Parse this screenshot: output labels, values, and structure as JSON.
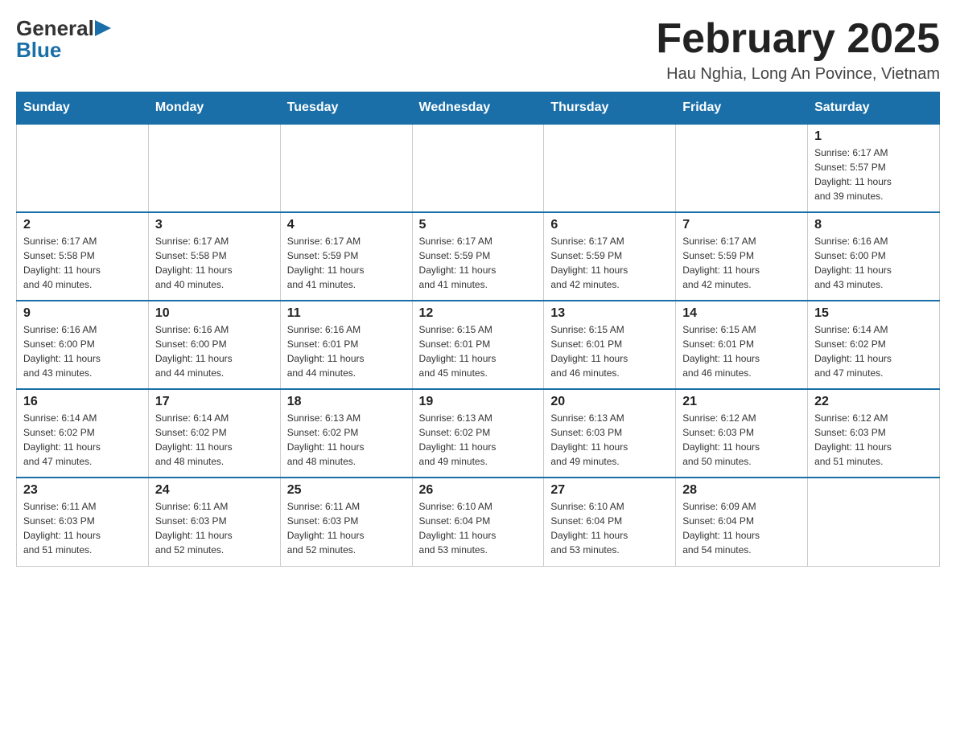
{
  "header": {
    "month_year": "February 2025",
    "location": "Hau Nghia, Long An Povince, Vietnam",
    "logo_general": "General",
    "logo_blue": "Blue"
  },
  "days_of_week": [
    "Sunday",
    "Monday",
    "Tuesday",
    "Wednesday",
    "Thursday",
    "Friday",
    "Saturday"
  ],
  "weeks": [
    [
      {
        "day": "",
        "info": ""
      },
      {
        "day": "",
        "info": ""
      },
      {
        "day": "",
        "info": ""
      },
      {
        "day": "",
        "info": ""
      },
      {
        "day": "",
        "info": ""
      },
      {
        "day": "",
        "info": ""
      },
      {
        "day": "1",
        "info": "Sunrise: 6:17 AM\nSunset: 5:57 PM\nDaylight: 11 hours\nand 39 minutes."
      }
    ],
    [
      {
        "day": "2",
        "info": "Sunrise: 6:17 AM\nSunset: 5:58 PM\nDaylight: 11 hours\nand 40 minutes."
      },
      {
        "day": "3",
        "info": "Sunrise: 6:17 AM\nSunset: 5:58 PM\nDaylight: 11 hours\nand 40 minutes."
      },
      {
        "day": "4",
        "info": "Sunrise: 6:17 AM\nSunset: 5:59 PM\nDaylight: 11 hours\nand 41 minutes."
      },
      {
        "day": "5",
        "info": "Sunrise: 6:17 AM\nSunset: 5:59 PM\nDaylight: 11 hours\nand 41 minutes."
      },
      {
        "day": "6",
        "info": "Sunrise: 6:17 AM\nSunset: 5:59 PM\nDaylight: 11 hours\nand 42 minutes."
      },
      {
        "day": "7",
        "info": "Sunrise: 6:17 AM\nSunset: 5:59 PM\nDaylight: 11 hours\nand 42 minutes."
      },
      {
        "day": "8",
        "info": "Sunrise: 6:16 AM\nSunset: 6:00 PM\nDaylight: 11 hours\nand 43 minutes."
      }
    ],
    [
      {
        "day": "9",
        "info": "Sunrise: 6:16 AM\nSunset: 6:00 PM\nDaylight: 11 hours\nand 43 minutes."
      },
      {
        "day": "10",
        "info": "Sunrise: 6:16 AM\nSunset: 6:00 PM\nDaylight: 11 hours\nand 44 minutes."
      },
      {
        "day": "11",
        "info": "Sunrise: 6:16 AM\nSunset: 6:01 PM\nDaylight: 11 hours\nand 44 minutes."
      },
      {
        "day": "12",
        "info": "Sunrise: 6:15 AM\nSunset: 6:01 PM\nDaylight: 11 hours\nand 45 minutes."
      },
      {
        "day": "13",
        "info": "Sunrise: 6:15 AM\nSunset: 6:01 PM\nDaylight: 11 hours\nand 46 minutes."
      },
      {
        "day": "14",
        "info": "Sunrise: 6:15 AM\nSunset: 6:01 PM\nDaylight: 11 hours\nand 46 minutes."
      },
      {
        "day": "15",
        "info": "Sunrise: 6:14 AM\nSunset: 6:02 PM\nDaylight: 11 hours\nand 47 minutes."
      }
    ],
    [
      {
        "day": "16",
        "info": "Sunrise: 6:14 AM\nSunset: 6:02 PM\nDaylight: 11 hours\nand 47 minutes."
      },
      {
        "day": "17",
        "info": "Sunrise: 6:14 AM\nSunset: 6:02 PM\nDaylight: 11 hours\nand 48 minutes."
      },
      {
        "day": "18",
        "info": "Sunrise: 6:13 AM\nSunset: 6:02 PM\nDaylight: 11 hours\nand 48 minutes."
      },
      {
        "day": "19",
        "info": "Sunrise: 6:13 AM\nSunset: 6:02 PM\nDaylight: 11 hours\nand 49 minutes."
      },
      {
        "day": "20",
        "info": "Sunrise: 6:13 AM\nSunset: 6:03 PM\nDaylight: 11 hours\nand 49 minutes."
      },
      {
        "day": "21",
        "info": "Sunrise: 6:12 AM\nSunset: 6:03 PM\nDaylight: 11 hours\nand 50 minutes."
      },
      {
        "day": "22",
        "info": "Sunrise: 6:12 AM\nSunset: 6:03 PM\nDaylight: 11 hours\nand 51 minutes."
      }
    ],
    [
      {
        "day": "23",
        "info": "Sunrise: 6:11 AM\nSunset: 6:03 PM\nDaylight: 11 hours\nand 51 minutes."
      },
      {
        "day": "24",
        "info": "Sunrise: 6:11 AM\nSunset: 6:03 PM\nDaylight: 11 hours\nand 52 minutes."
      },
      {
        "day": "25",
        "info": "Sunrise: 6:11 AM\nSunset: 6:03 PM\nDaylight: 11 hours\nand 52 minutes."
      },
      {
        "day": "26",
        "info": "Sunrise: 6:10 AM\nSunset: 6:04 PM\nDaylight: 11 hours\nand 53 minutes."
      },
      {
        "day": "27",
        "info": "Sunrise: 6:10 AM\nSunset: 6:04 PM\nDaylight: 11 hours\nand 53 minutes."
      },
      {
        "day": "28",
        "info": "Sunrise: 6:09 AM\nSunset: 6:04 PM\nDaylight: 11 hours\nand 54 minutes."
      },
      {
        "day": "",
        "info": ""
      }
    ]
  ],
  "colors": {
    "header_bg": "#1a6fa8",
    "header_text": "#ffffff",
    "border": "#cccccc",
    "day_number": "#222222"
  }
}
